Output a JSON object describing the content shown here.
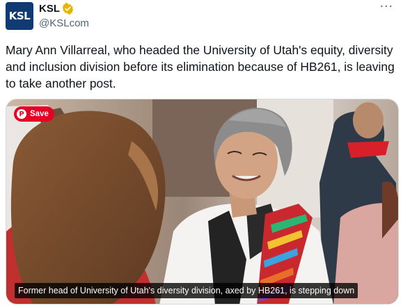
{
  "author": {
    "avatar_text": "KSL",
    "display_name": "KSL",
    "handle": "@KSLcom",
    "verified_icon": "gold-verified-badge-icon"
  },
  "more_icon": "···",
  "tweet": {
    "text": "Mary Ann Villarreal, who headed the University of Utah's equity, diversity and inclusion division before its elimination because of HB261, is leaving to take another post."
  },
  "media": {
    "save_label": "Save",
    "save_icon": "pinterest-icon",
    "caption": "Former head of University of Utah's diversity division, axed by HB261, is stepping down"
  },
  "colors": {
    "brand_navy": "#0f3b72",
    "verified_gold": "#e7b400",
    "pinterest_red": "#e60023",
    "secondary_text": "#536471"
  }
}
